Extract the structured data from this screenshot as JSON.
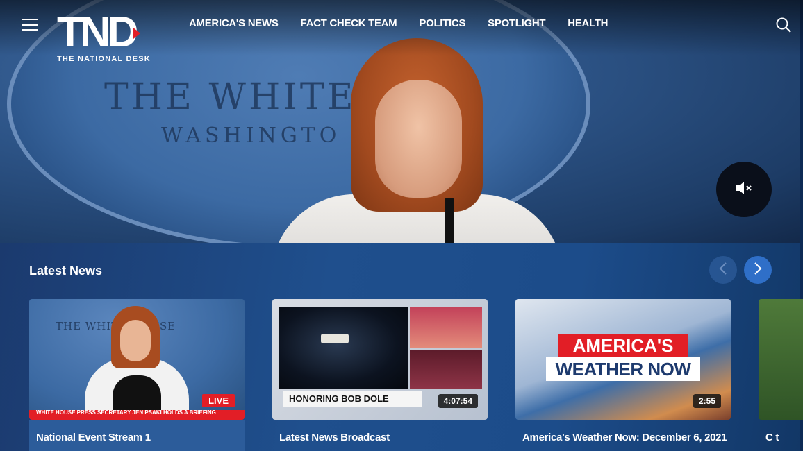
{
  "brand": {
    "logo_mark": "TND",
    "logo_sub": "THE NATIONAL DESK",
    "accent": "#e21e26"
  },
  "nav": {
    "items": [
      "AMERICA'S NEWS",
      "FACT CHECK TEAM",
      "POLITICS",
      "SPOTLIGHT",
      "HEALTH"
    ]
  },
  "hero": {
    "seal_line1": "THE WHITE H",
    "seal_line2": "WASHINGTO"
  },
  "latest": {
    "title": "Latest News",
    "cards": [
      {
        "title": "National Event Stream 1",
        "badge": "LIVE",
        "thumb_line1": "THE WHITE HOUSE",
        "lower_third": "WHITE HOUSE PRESS SECRETARY JEN PSAKI HOLDS A BRIEFING"
      },
      {
        "title": "Latest News Broadcast",
        "badge": "4:07:54",
        "tag": "HONORING BOB DOLE"
      },
      {
        "title": "America's Weather Now: December 6, 2021",
        "badge": "2:55",
        "word1": "AMERICA'S",
        "word2": "WEATHER NOW"
      },
      {
        "title": "C t"
      }
    ]
  }
}
